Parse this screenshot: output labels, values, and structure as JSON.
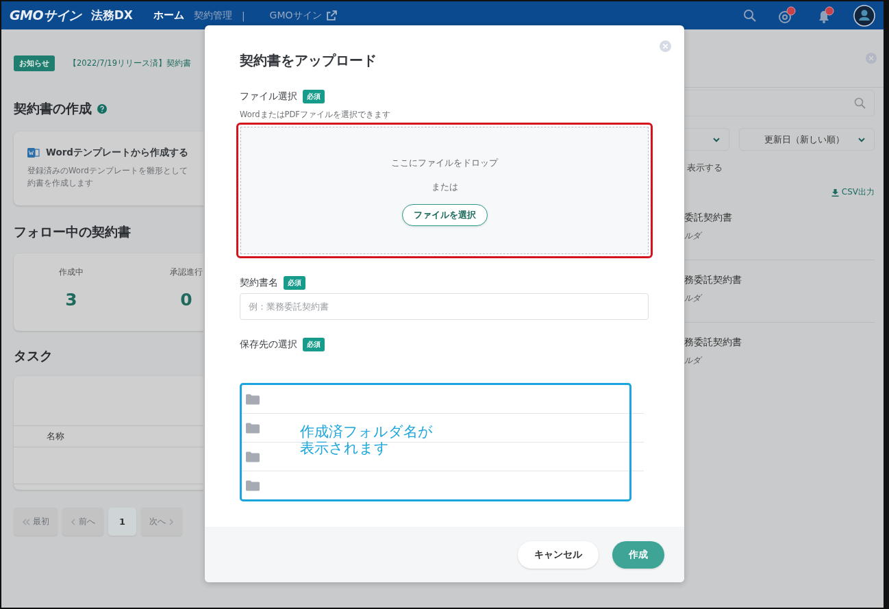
{
  "header": {
    "logo": "GMOサイン",
    "product": "法務DX",
    "nav": [
      {
        "label": "ホーム",
        "selected": true,
        "kind": "link"
      },
      {
        "label": "契約管理",
        "selected": false,
        "kind": "link",
        "divider": "|"
      },
      {
        "label": "GMOサイン",
        "selected": false,
        "kind": "external"
      }
    ],
    "mentions_unread": true,
    "notifications_unread": true
  },
  "home": {
    "notice": {
      "badge": "お知らせ",
      "text": "【2022/7/19リリース済】契約書"
    },
    "create_heading": "契約書の作成",
    "template_card": {
      "title": "Wordテンプレートから作成する",
      "lines": [
        "登録済みのWordテンプレートを雛形として",
        "約書を作成します"
      ]
    },
    "follow_heading": "フォロー中の契約書",
    "stats": [
      {
        "label": "作成中",
        "value": "3"
      },
      {
        "label": "承認進行",
        "value": "0"
      }
    ],
    "task_heading": "タスク",
    "table": {
      "columns": [
        "名称"
      ]
    },
    "pagination": [
      {
        "label": "最初",
        "kind": "first",
        "selected": false
      },
      {
        "label": "前へ",
        "kind": "prev",
        "selected": false
      },
      {
        "label": "1",
        "kind": "page",
        "selected": true
      },
      {
        "label": "次へ",
        "kind": "next",
        "selected": false
      }
    ]
  },
  "side_panel": {
    "sort": "更新日（新しい順）",
    "filter_text": "表示する",
    "csv": "CSV出力",
    "items": [
      {
        "title": "委託契約書",
        "folder": "ルダ"
      },
      {
        "title": "務委託契約書",
        "folder": "ルダ"
      },
      {
        "title": "務委託契約書",
        "folder": "ルダ"
      }
    ]
  },
  "modal": {
    "title": "契約書をアップロード",
    "file": {
      "label": "ファイル選択",
      "required": "必須",
      "hint": "WordまたはPDFファイルを選択できます",
      "drop_text": "ここにファイルをドロップ",
      "or": "または",
      "button": "ファイルを選択",
      "highlight": {
        "color": "#d3141c"
      }
    },
    "name": {
      "label": "契約書名",
      "required": "必須",
      "placeholder": "例：業務委託契約書"
    },
    "folder": {
      "label": "保存先の選択",
      "required": "必須",
      "highlight": {
        "color": "#1aa6dc"
      },
      "rows": [
        {
          "kind": "folder"
        },
        {
          "kind": "folder"
        },
        {
          "kind": "folder"
        },
        {
          "kind": "folder"
        }
      ],
      "note": [
        "作成済フォルダ名が",
        "表示されます"
      ]
    },
    "buttons": [
      {
        "label": "キャンセル",
        "kind": "secondary"
      },
      {
        "label": "作成",
        "kind": "primary"
      }
    ]
  }
}
